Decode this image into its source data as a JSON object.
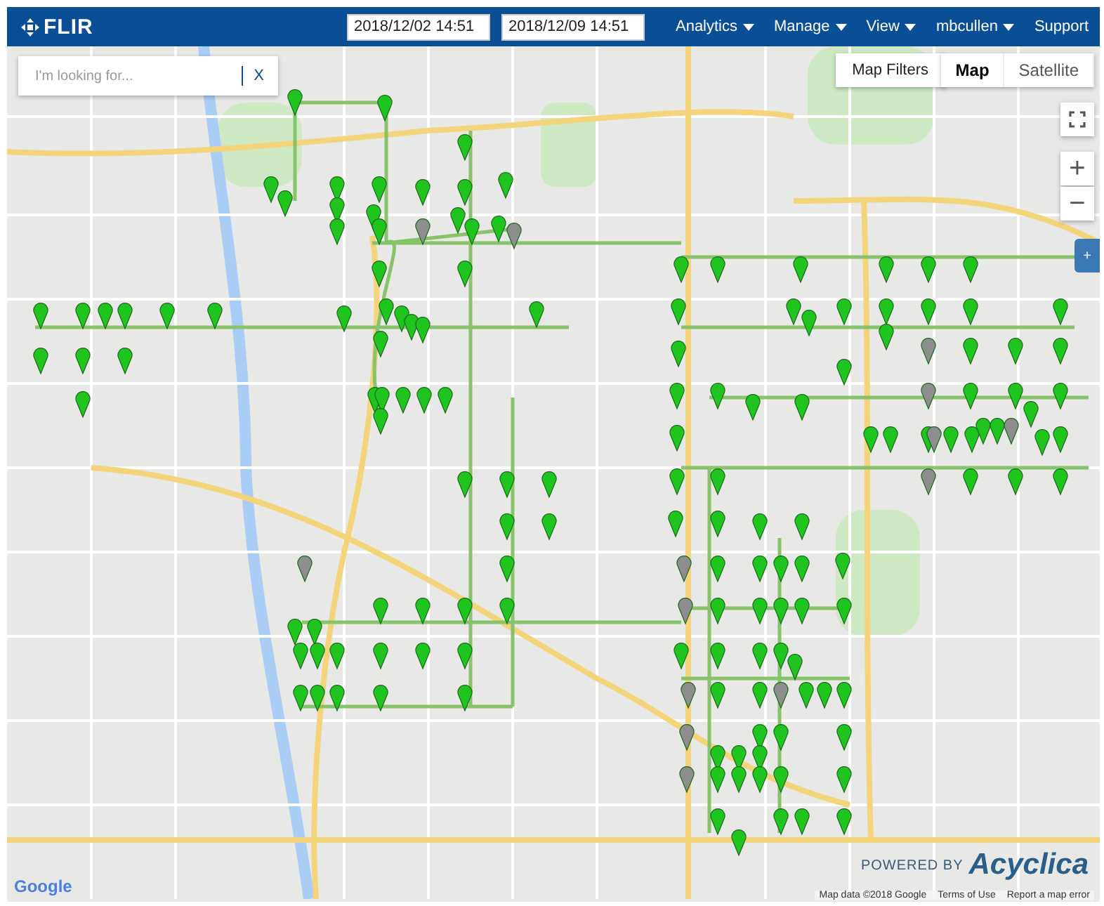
{
  "header": {
    "logo": "FLIR",
    "start_date": "2018/12/02 14:51",
    "end_date": "2018/12/09 14:51",
    "menus": [
      {
        "label": "Analytics",
        "dropdown": true
      },
      {
        "label": "Manage",
        "dropdown": true
      },
      {
        "label": "View",
        "dropdown": true
      },
      {
        "label": "mbcullen",
        "dropdown": true
      },
      {
        "label": "Support",
        "dropdown": false
      }
    ]
  },
  "search": {
    "placeholder": "I'm looking for...",
    "clear": "X"
  },
  "map": {
    "filters_button": "Map Filters",
    "types": [
      {
        "label": "Map",
        "selected": true
      },
      {
        "label": "Satellite",
        "selected": false
      }
    ],
    "zoom_in": "+",
    "zoom_out": "−",
    "side_tab": "+",
    "powered_by": "POWERED BY",
    "brand": "Acyclica",
    "google": "Google",
    "attribution": [
      "Map data ©2018 Google",
      "Terms of Use",
      "Report a map error"
    ]
  }
}
